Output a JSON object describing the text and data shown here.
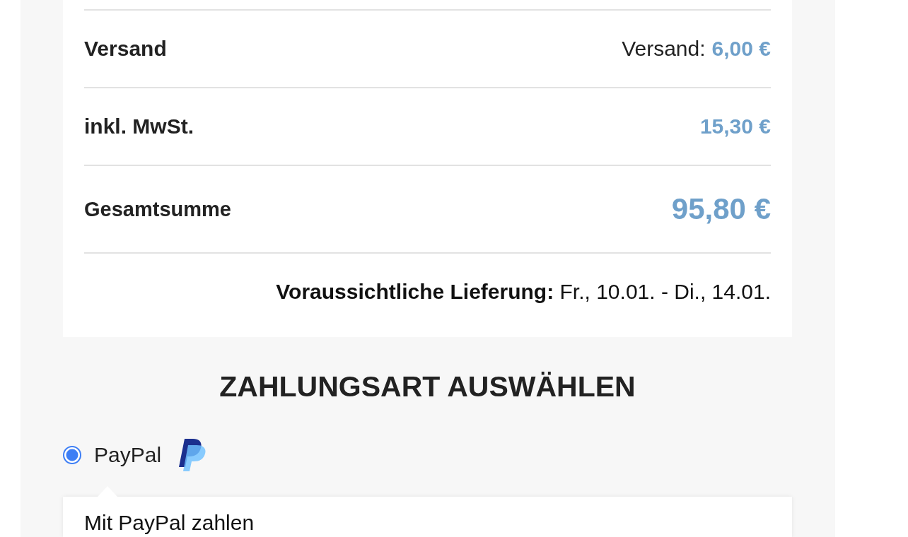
{
  "order_summary": {
    "rows": [
      {
        "kind": "line",
        "label": "Versand",
        "value_prefix": "Versand:",
        "value": "6,00 €"
      },
      {
        "kind": "line",
        "label": "inkl. MwSt.",
        "value": "15,30 €"
      },
      {
        "kind": "total",
        "label": "Gesamtsumme",
        "value": "95,80 €"
      }
    ],
    "delivery": "**Voraussichtliche Lieferung:** Fr., 10.01. - Di., 14.01."
  },
  "payment": {
    "heading": "ZAHLUNGSART AUSWÄHLEN",
    "options": [
      {
        "label": "PayPal",
        "selected": true
      }
    ],
    "panel": {
      "text": "Mit PayPal zahlen"
    }
  }
}
